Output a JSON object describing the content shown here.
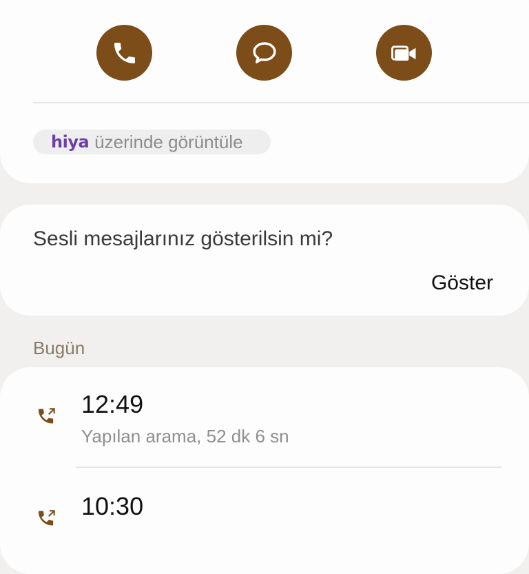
{
  "actions": {
    "call_icon": "phone-icon",
    "message_icon": "message-icon",
    "video_icon": "video-call-icon",
    "accent_color": "#7c4c19"
  },
  "hiya": {
    "logo": "hiya",
    "text": "üzerinde görüntüle",
    "logo_color": "#6b3fa8"
  },
  "voicemail": {
    "question": "Sesli mesajlarınız gösterilsin mi?",
    "show_label": "Göster"
  },
  "call_log": {
    "section_title": "Bugün",
    "entries": [
      {
        "time": "12:49",
        "description": "Yapılan arama, 52 dk 6 sn",
        "icon": "outgoing-call-icon"
      },
      {
        "time": "10:30",
        "description": "",
        "icon": "outgoing-call-icon"
      }
    ]
  }
}
